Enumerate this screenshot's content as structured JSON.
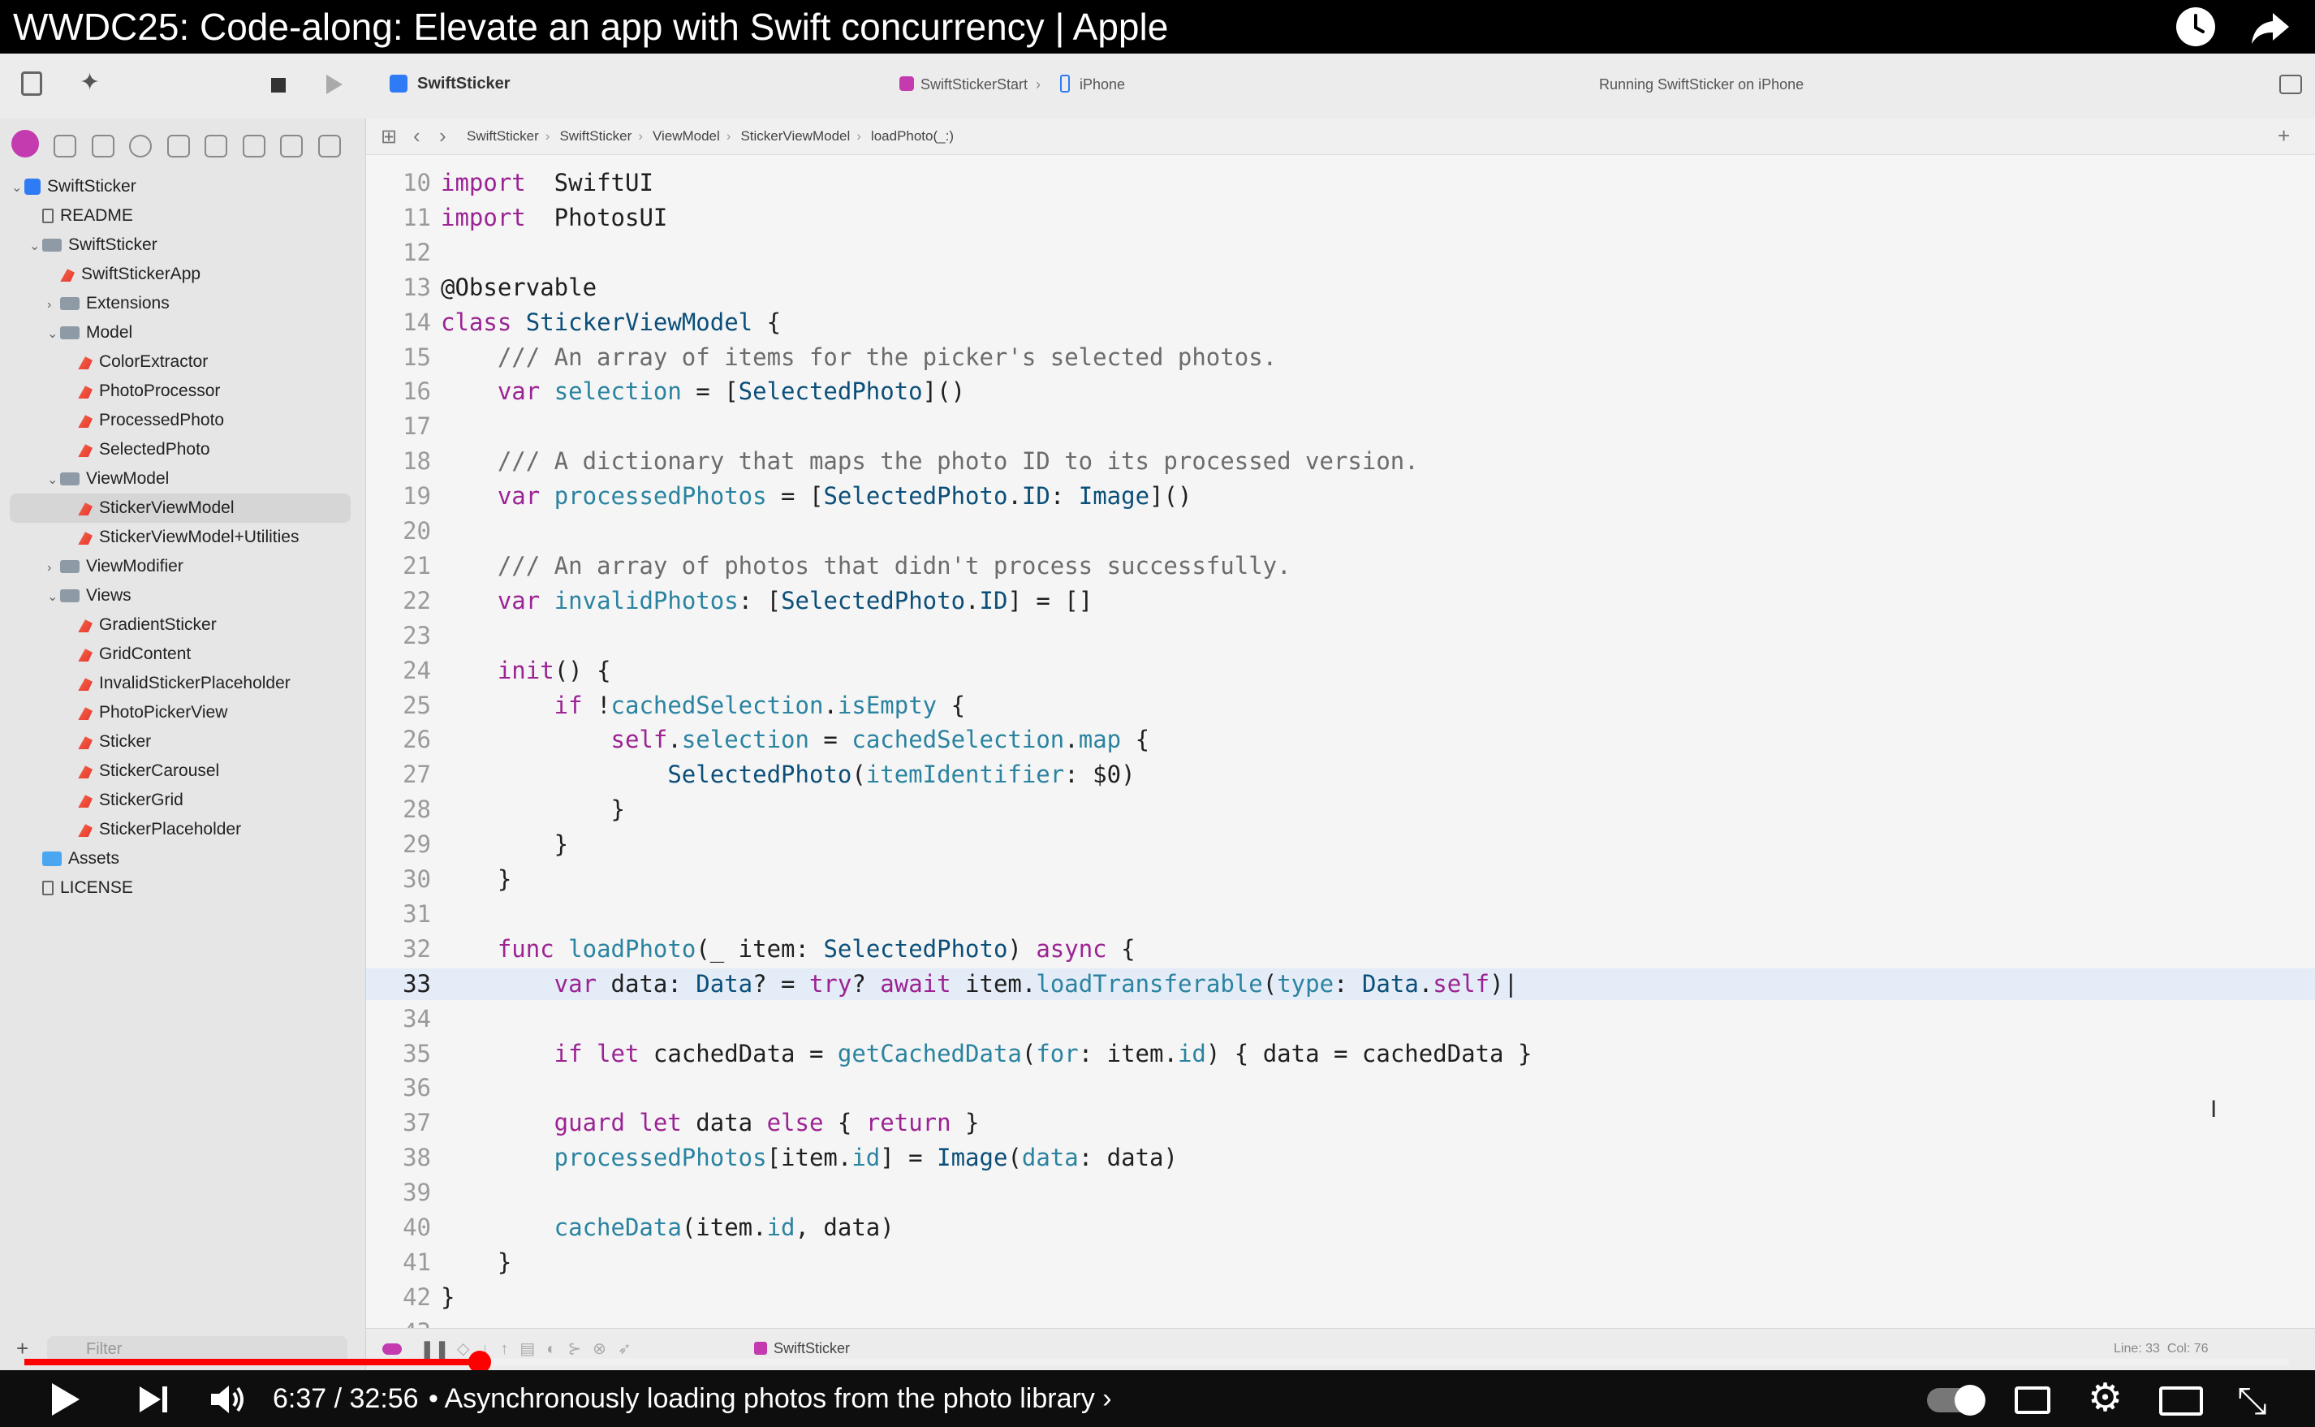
{
  "video": {
    "title": "WWDC25: Code-along: Elevate an app with Swift concurrency | Apple",
    "time": "6:37 / 32:56",
    "chapter": "• Asynchronously loading photos from the photo library ›",
    "progress_fraction": 0.201
  },
  "toolbar": {
    "project": "SwiftSticker",
    "scheme": "SwiftStickerStart",
    "device": "iPhone",
    "status": "Running SwiftSticker on iPhone"
  },
  "breadcrumb": [
    "SwiftSticker",
    "SwiftSticker",
    "ViewModel",
    "StickerViewModel",
    "loadPhoto(_:)"
  ],
  "sidebar": {
    "filter_placeholder": "Filter",
    "items": [
      {
        "label": "SwiftSticker",
        "icon": "project-icon",
        "depth": 0,
        "chevron": "v"
      },
      {
        "label": "README",
        "icon": "book-icon",
        "depth": 1,
        "chevron": ""
      },
      {
        "label": "SwiftSticker",
        "icon": "folder-icon",
        "depth": 1,
        "chevron": "v"
      },
      {
        "label": "SwiftStickerApp",
        "icon": "swift-file-icon",
        "depth": 2,
        "chevron": ""
      },
      {
        "label": "Extensions",
        "icon": "folder-icon",
        "depth": 2,
        "chevron": ">"
      },
      {
        "label": "Model",
        "icon": "folder-icon",
        "depth": 2,
        "chevron": "v"
      },
      {
        "label": "ColorExtractor",
        "icon": "swift-file-icon",
        "depth": 3,
        "chevron": ""
      },
      {
        "label": "PhotoProcessor",
        "icon": "swift-file-icon",
        "depth": 3,
        "chevron": ""
      },
      {
        "label": "ProcessedPhoto",
        "icon": "swift-file-icon",
        "depth": 3,
        "chevron": ""
      },
      {
        "label": "SelectedPhoto",
        "icon": "swift-file-icon",
        "depth": 3,
        "chevron": ""
      },
      {
        "label": "ViewModel",
        "icon": "folder-icon",
        "depth": 2,
        "chevron": "v"
      },
      {
        "label": "StickerViewModel",
        "icon": "swift-file-icon",
        "depth": 3,
        "chevron": "",
        "selected": true
      },
      {
        "label": "StickerViewModel+Utilities",
        "icon": "swift-file-icon",
        "depth": 3,
        "chevron": ""
      },
      {
        "label": "ViewModifier",
        "icon": "folder-icon",
        "depth": 2,
        "chevron": ">"
      },
      {
        "label": "Views",
        "icon": "folder-icon",
        "depth": 2,
        "chevron": "v"
      },
      {
        "label": "GradientSticker",
        "icon": "swift-file-icon",
        "depth": 3,
        "chevron": ""
      },
      {
        "label": "GridContent",
        "icon": "swift-file-icon",
        "depth": 3,
        "chevron": ""
      },
      {
        "label": "InvalidStickerPlaceholder",
        "icon": "swift-file-icon",
        "depth": 3,
        "chevron": ""
      },
      {
        "label": "PhotoPickerView",
        "icon": "swift-file-icon",
        "depth": 3,
        "chevron": ""
      },
      {
        "label": "Sticker",
        "icon": "swift-file-icon",
        "depth": 3,
        "chevron": ""
      },
      {
        "label": "StickerCarousel",
        "icon": "swift-file-icon",
        "depth": 3,
        "chevron": ""
      },
      {
        "label": "StickerGrid",
        "icon": "swift-file-icon",
        "depth": 3,
        "chevron": ""
      },
      {
        "label": "StickerPlaceholder",
        "icon": "swift-file-icon",
        "depth": 3,
        "chevron": ""
      },
      {
        "label": "Assets",
        "icon": "assets-icon",
        "depth": 1,
        "chevron": ""
      },
      {
        "label": "LICENSE",
        "icon": "doc-icon",
        "depth": 1,
        "chevron": ""
      }
    ]
  },
  "editor": {
    "current_line": 33,
    "lines": [
      {
        "n": "10",
        "tokens": [
          [
            "kw",
            "import"
          ],
          [
            "",
            "  SwiftUI"
          ]
        ]
      },
      {
        "n": "11",
        "tokens": [
          [
            "kw",
            "import"
          ],
          [
            "",
            "  PhotosUI"
          ]
        ]
      },
      {
        "n": "12",
        "tokens": []
      },
      {
        "n": "13",
        "tokens": [
          [
            "",
            "@Observable"
          ]
        ]
      },
      {
        "n": "14",
        "tokens": [
          [
            "kw",
            "class"
          ],
          [
            "",
            " "
          ],
          [
            "tp",
            "StickerViewModel"
          ],
          [
            "",
            " {"
          ]
        ]
      },
      {
        "n": "15",
        "tokens": [
          [
            "cm",
            "    /// An array of items for the picker's selected photos."
          ]
        ]
      },
      {
        "n": "16",
        "tokens": [
          [
            "kw",
            "    var"
          ],
          [
            "",
            " "
          ],
          [
            "fn",
            "selection"
          ],
          [
            "",
            " = ["
          ],
          [
            "tp",
            "SelectedPhoto"
          ],
          [
            "",
            "]()"
          ]
        ]
      },
      {
        "n": "17",
        "tokens": []
      },
      {
        "n": "18",
        "tokens": [
          [
            "cm",
            "    /// A dictionary that maps the photo ID to its processed version."
          ]
        ]
      },
      {
        "n": "19",
        "tokens": [
          [
            "kw",
            "    var"
          ],
          [
            "",
            " "
          ],
          [
            "fn",
            "processedPhotos"
          ],
          [
            "",
            " = ["
          ],
          [
            "tp",
            "SelectedPhoto"
          ],
          [
            "",
            "."
          ],
          [
            "tp",
            "ID"
          ],
          [
            "",
            ": "
          ],
          [
            "tp",
            "Image"
          ],
          [
            "",
            "]()"
          ]
        ]
      },
      {
        "n": "20",
        "tokens": []
      },
      {
        "n": "21",
        "tokens": [
          [
            "cm",
            "    /// An array of photos that didn't process successfully."
          ]
        ]
      },
      {
        "n": "22",
        "tokens": [
          [
            "kw",
            "    var"
          ],
          [
            "",
            " "
          ],
          [
            "fn",
            "invalidPhotos"
          ],
          [
            "",
            ": ["
          ],
          [
            "tp",
            "SelectedPhoto"
          ],
          [
            "",
            "."
          ],
          [
            "tp",
            "ID"
          ],
          [
            "",
            "] = []"
          ]
        ]
      },
      {
        "n": "23",
        "tokens": []
      },
      {
        "n": "24",
        "tokens": [
          [
            "kw",
            "    init"
          ],
          [
            "",
            "() {"
          ]
        ]
      },
      {
        "n": "25",
        "tokens": [
          [
            "kw",
            "        if"
          ],
          [
            "",
            " !"
          ],
          [
            "fn",
            "cachedSelection"
          ],
          [
            "",
            "."
          ],
          [
            "fn",
            "isEmpty"
          ],
          [
            "",
            " {"
          ]
        ]
      },
      {
        "n": "26",
        "tokens": [
          [
            "kw",
            "            self"
          ],
          [
            "",
            "."
          ],
          [
            "fn",
            "selection"
          ],
          [
            "",
            " = "
          ],
          [
            "fn",
            "cachedSelection"
          ],
          [
            "",
            "."
          ],
          [
            "fn",
            "map"
          ],
          [
            "",
            " {"
          ]
        ]
      },
      {
        "n": "27",
        "tokens": [
          [
            "tp",
            "                SelectedPhoto"
          ],
          [
            "",
            "("
          ],
          [
            "fn",
            "itemIdentifier"
          ],
          [
            "",
            ": $0)"
          ]
        ]
      },
      {
        "n": "28",
        "tokens": [
          [
            "",
            "            }"
          ]
        ]
      },
      {
        "n": "29",
        "tokens": [
          [
            "",
            "        }"
          ]
        ]
      },
      {
        "n": "30",
        "tokens": [
          [
            "",
            "    }"
          ]
        ]
      },
      {
        "n": "31",
        "tokens": []
      },
      {
        "n": "32",
        "tokens": [
          [
            "kw",
            "    func"
          ],
          [
            "",
            " "
          ],
          [
            "fn",
            "loadPhoto"
          ],
          [
            "",
            "(_ item: "
          ],
          [
            "tp",
            "SelectedPhoto"
          ],
          [
            "",
            ") "
          ],
          [
            "kw",
            "async"
          ],
          [
            "",
            " {"
          ]
        ]
      },
      {
        "n": "33",
        "tokens": [
          [
            "kw",
            "        var"
          ],
          [
            "",
            " data: "
          ],
          [
            "tp",
            "Data"
          ],
          [
            "",
            "? = "
          ],
          [
            "kw",
            "try"
          ],
          [
            "",
            "? "
          ],
          [
            "kw",
            "await"
          ],
          [
            "",
            " item."
          ],
          [
            "fn",
            "loadTransferable"
          ],
          [
            "",
            "("
          ],
          [
            "fn",
            "type"
          ],
          [
            "",
            ": "
          ],
          [
            "tp",
            "Data"
          ],
          [
            "",
            "."
          ],
          [
            "kw",
            "self"
          ],
          [
            "",
            ")|"
          ]
        ]
      },
      {
        "n": "34",
        "tokens": []
      },
      {
        "n": "35",
        "tokens": [
          [
            "kw",
            "        if let"
          ],
          [
            "",
            " cachedData = "
          ],
          [
            "fn",
            "getCachedData"
          ],
          [
            "",
            "("
          ],
          [
            "fn",
            "for"
          ],
          [
            "",
            ": item."
          ],
          [
            "fn",
            "id"
          ],
          [
            "",
            ") { data = cachedData }"
          ]
        ]
      },
      {
        "n": "36",
        "tokens": []
      },
      {
        "n": "37",
        "tokens": [
          [
            "kw",
            "        guard let"
          ],
          [
            "",
            " data "
          ],
          [
            "kw",
            "else"
          ],
          [
            "",
            " { "
          ],
          [
            "kw",
            "return"
          ],
          [
            "",
            " }"
          ]
        ]
      },
      {
        "n": "38",
        "tokens": [
          [
            "fn",
            "        processedPhotos"
          ],
          [
            "",
            "[item."
          ],
          [
            "fn",
            "id"
          ],
          [
            "",
            "] = "
          ],
          [
            "tp",
            "Image"
          ],
          [
            "",
            "("
          ],
          [
            "fn",
            "data"
          ],
          [
            "",
            ": data)"
          ]
        ]
      },
      {
        "n": "39",
        "tokens": []
      },
      {
        "n": "40",
        "tokens": [
          [
            "fn",
            "        cacheData"
          ],
          [
            "",
            "(item."
          ],
          [
            "fn",
            "id"
          ],
          [
            "",
            ", data)"
          ]
        ]
      },
      {
        "n": "41",
        "tokens": [
          [
            "",
            "    }"
          ]
        ]
      },
      {
        "n": "42",
        "tokens": [
          [
            "",
            "}"
          ]
        ]
      },
      {
        "n": "43",
        "tokens": []
      }
    ]
  },
  "debug": {
    "target": "SwiftSticker",
    "position": "Line: 33  Col: 76"
  },
  "colors": {
    "keyword": "#9b2393",
    "type": "#0b4f79",
    "function": "#2a83a0",
    "comment": "#6c6c6c",
    "youtube_red": "#ff0000"
  }
}
